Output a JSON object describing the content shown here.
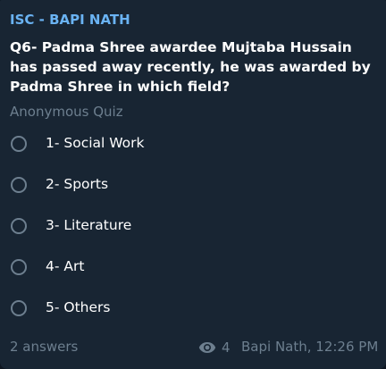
{
  "message": {
    "channel_name": "ISC - BAPI NATH",
    "question": "Q6- Padma Shree awardee Mujtaba Hussain has passed away recently, he was awarded by Padma Shree in which field?",
    "quiz_type": "Anonymous Quiz",
    "options": [
      {
        "label": "1- Social Work"
      },
      {
        "label": "2- Sports"
      },
      {
        "label": "3- Literature"
      },
      {
        "label": "4- Art"
      },
      {
        "label": "5- Others"
      }
    ],
    "answers_count": "2 answers",
    "views": "4",
    "author_time": "Bapi Nath, 12:26 PM"
  },
  "icons": {
    "views": "eye-icon",
    "option_radio": "radio-circle-icon"
  },
  "colors": {
    "background": "#182533",
    "channel_name": "#6ab3f3",
    "muted_text": "#6d7f8f",
    "text": "#ffffff"
  }
}
